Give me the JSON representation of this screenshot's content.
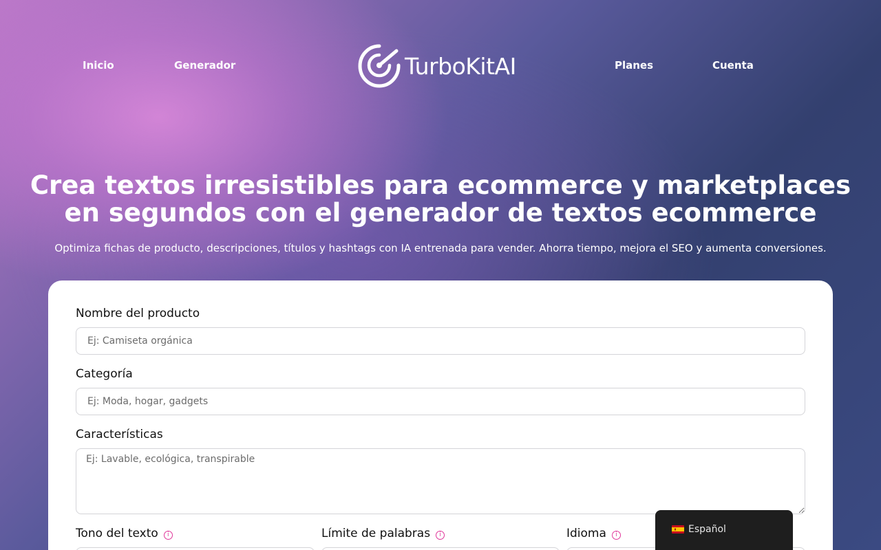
{
  "header": {
    "nav_left": [
      "Inicio",
      "Generador"
    ],
    "nav_right": [
      "Planes",
      "Cuenta"
    ],
    "logo_text": "TurboKitAI"
  },
  "hero": {
    "title_line1": "Crea textos irresistibles para ecommerce y marketplaces",
    "title_line2": "en segundos con el generador de textos ecommerce",
    "subtitle": "Optimiza fichas de producto, descripciones, títulos y hashtags con IA entrenada para vender. Ahorra tiempo, mejora el SEO y aumenta conversiones."
  },
  "form": {
    "product_name": {
      "label": "Nombre del producto",
      "value": "",
      "placeholder": "Ej: Camiseta orgánica"
    },
    "category": {
      "label": "Categoría",
      "value": "",
      "placeholder": "Ej: Moda, hogar, gadgets"
    },
    "features": {
      "label": "Características",
      "value": "",
      "placeholder": "Ej: Lavable, ecológica, transpirable"
    },
    "tone": {
      "label": "Tono del texto",
      "info_icon": "info-icon"
    },
    "word_limit": {
      "label": "Límite de palabras",
      "info_icon": "info-icon"
    },
    "language": {
      "label": "Idioma",
      "info_icon": "info-icon"
    }
  },
  "language_switcher": {
    "label": "Español",
    "flag_icon": "spain-flag-icon"
  },
  "colors": {
    "accent_pink": "#e0369a",
    "card_bg": "#ffffff",
    "switcher_bg": "#1e1e1e"
  }
}
